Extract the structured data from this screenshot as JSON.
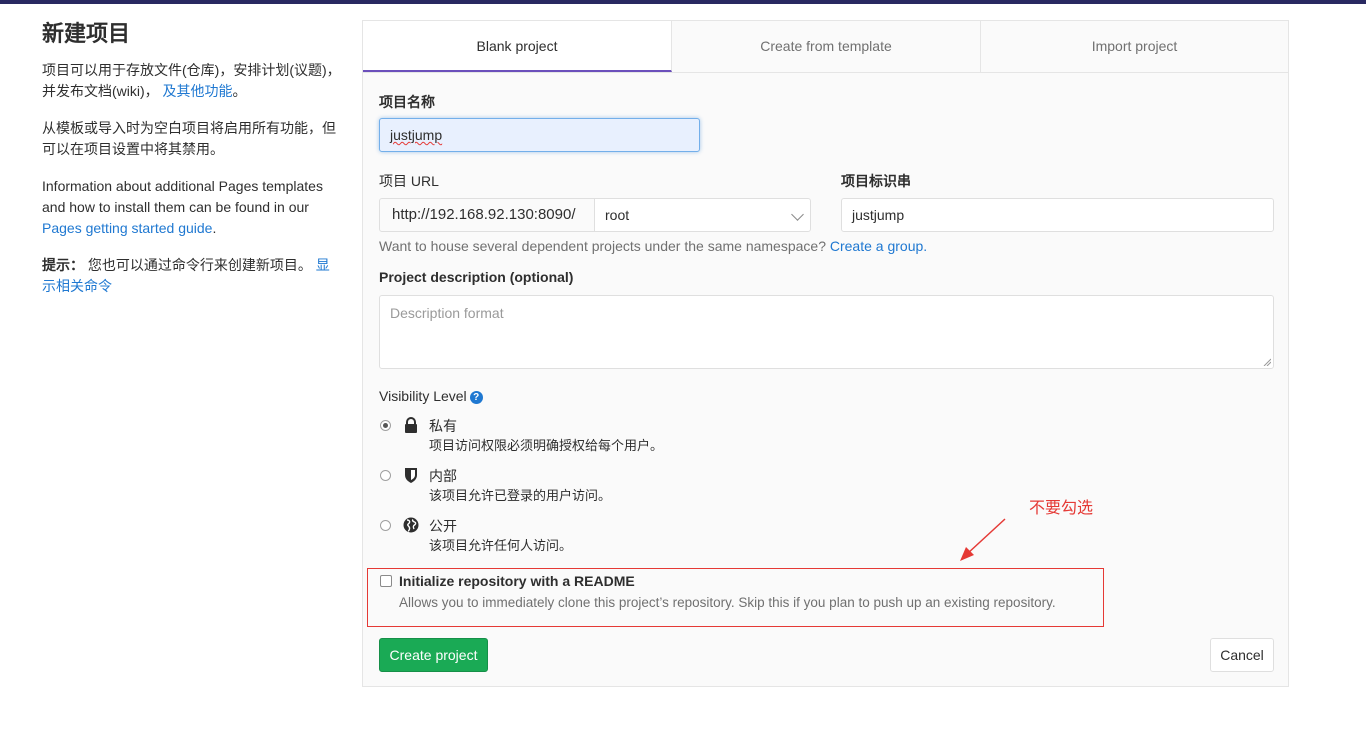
{
  "left": {
    "title": "新建项目",
    "intro_text": "项目可以用于存放文件(仓库)，安排计划(议题)，并发布文档(wiki)，",
    "intro_link": "及其他功能",
    "intro_end": "。",
    "template_note": "从模板或导入时为空白项目将启用所有功能，但可以在项目设置中将其禁用。",
    "pages_text": "Information about additional Pages templates and how to install them can be found in our ",
    "pages_link": "Pages getting started guide",
    "pages_end": ".",
    "tip_label": "提示：",
    "tip_text": " 您也可以通过命令行来创建新项目。 ",
    "tip_link": "显示相关命令"
  },
  "tabs": {
    "blank": "Blank project",
    "template": "Create from template",
    "import": "Import project"
  },
  "form": {
    "name_label": "项目名称",
    "name_value": "justjump",
    "url_label": "项目 URL",
    "url_prefix": "http://192.168.92.130:8090/",
    "namespace_value": "root",
    "slug_label": "项目标识串",
    "slug_value": "justjump",
    "group_hint": "Want to house several dependent projects under the same namespace? ",
    "group_link": "Create a group.",
    "description_label": "Project description (optional)",
    "description_placeholder": "Description format",
    "visibility_label": "Visibility Level",
    "help_icon": "?",
    "visibility": [
      {
        "title": "私有",
        "desc": "项目访问权限必须明确授权给每个用户。",
        "icon": "lock-icon",
        "checked": true
      },
      {
        "title": "内部",
        "desc": "该项目允许已登录的用户访问。",
        "icon": "shield-icon",
        "checked": false
      },
      {
        "title": "公开",
        "desc": "该项目允许任何人访问。",
        "icon": "globe-icon",
        "checked": false
      }
    ],
    "readme_label": "Initialize repository with a README",
    "readme_desc": "Allows you to immediately clone this project’s repository. Skip this if you plan to push up an existing repository.",
    "create_button": "Create project",
    "cancel_button": "Cancel"
  },
  "annotation": {
    "text": "不要勾选",
    "color": "#e53935"
  },
  "colors": {
    "accent_tab": "#6b4fbb",
    "link": "#1f78d1",
    "create_button": "#1aaa55",
    "topbar": "#292961"
  }
}
